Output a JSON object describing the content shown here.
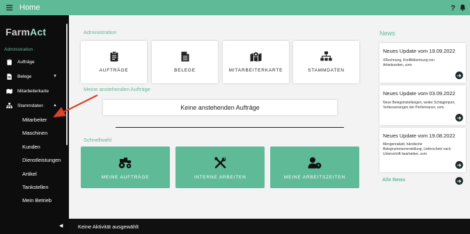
{
  "header": {
    "title": "Home",
    "help": "?"
  },
  "sidebar": {
    "logo_a": "Farm",
    "logo_b": "Act",
    "section": "Administration",
    "items": [
      {
        "label": "Aufträge",
        "icon": "clipboard-icon"
      },
      {
        "label": "Belege",
        "icon": "document-icon",
        "chevron": "▼"
      },
      {
        "label": "Mitarbeiterkarte",
        "icon": "map-icon"
      },
      {
        "label": "Stammdaten",
        "icon": "sitemap-icon",
        "chevron": "▲"
      }
    ],
    "subitems": [
      "Mitarbeiter",
      "Maschinen",
      "Kunden",
      "Dienstleistungen",
      "Artikel",
      "Tankstellen",
      "Mein Betrieb"
    ]
  },
  "main": {
    "administration_label": "Administration",
    "tiles": [
      {
        "label": "AUFTRÄGE",
        "icon": "clipboard-icon"
      },
      {
        "label": "BELEGE",
        "icon": "document-icon"
      },
      {
        "label": "MITARBEITERKARTE",
        "icon": "map-icon"
      },
      {
        "label": "STAMMDATEN",
        "icon": "sitemap-icon"
      }
    ],
    "pending_label": "Meine anstehenden Aufträge",
    "pending_empty": "Keine anstehenden Aufträge",
    "quick_label": "Schnellwahl",
    "quick": [
      {
        "label": "MEINE AUFTRÄGE",
        "icon": "tractor-icon"
      },
      {
        "label": "INTERNE ARBEITEN",
        "icon": "tools-icon"
      },
      {
        "label": "MEINE ARBEITSZEITEN",
        "icon": "user-clock-icon"
      }
    ]
  },
  "news": {
    "title": "News",
    "items": [
      {
        "heading": "Neues Update vom 19.09.2022",
        "text": "XRechnung, Konfliktkennung von Arbeitszeiten, uvm."
      },
      {
        "heading": "Neues Update vom 03.09.2022",
        "text": "Neue Belegeinstellungen, weiter Schlagimport, Verbesserungen der Performance, uvm."
      },
      {
        "heading": "Neues Update vom 19.08.2022",
        "text": "Mengenrabatt, händische Belegnummernerstellung, Lieferschein nach Unterschrift bearbeiten, uvm."
      }
    ],
    "all_news": "Alle News"
  },
  "status": {
    "text": "Keine Aktivität ausgewählt"
  },
  "colors": {
    "accent": "#5fba98",
    "sidebar": "#0d0d0d",
    "annotation_arrow": "#d9432b"
  }
}
